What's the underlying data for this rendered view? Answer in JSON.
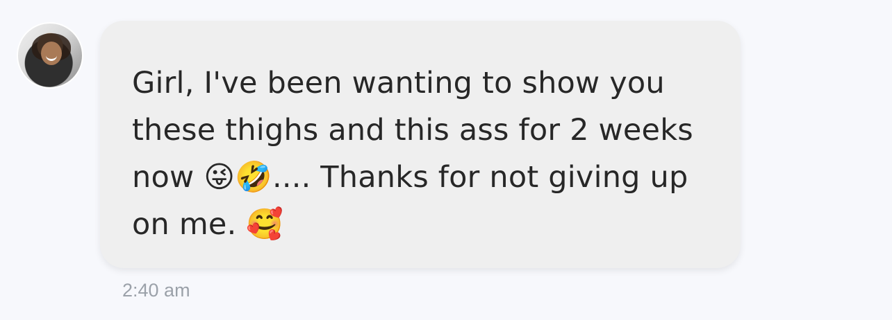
{
  "header": {
    "partial_text": ""
  },
  "message": {
    "text": "Girl, I've been wanting to show you\nthese thighs and this ass for 2 weeks\nnow 😜🤣.... Thanks for not giving up\non me. 🥰",
    "timestamp": "2:40 am"
  },
  "colors": {
    "background": "#f7f8fc",
    "bubble": "#efefef",
    "text": "#272727",
    "timestamp": "#9ba1a9"
  },
  "icons": {
    "avatar": "profile-photo"
  }
}
